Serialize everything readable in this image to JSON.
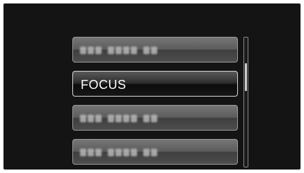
{
  "menu": {
    "items": [
      {
        "label": "",
        "obscured": true
      },
      {
        "label": "FOCUS",
        "obscured": false,
        "selected": true
      },
      {
        "label": "",
        "obscured": true
      },
      {
        "label": "",
        "obscured": true
      }
    ]
  },
  "scrollbar": {
    "position_fraction": 0.25
  },
  "colors": {
    "background": "#141414",
    "selected_border": "#d9d9d9",
    "item_border": "#9a9a9a"
  }
}
